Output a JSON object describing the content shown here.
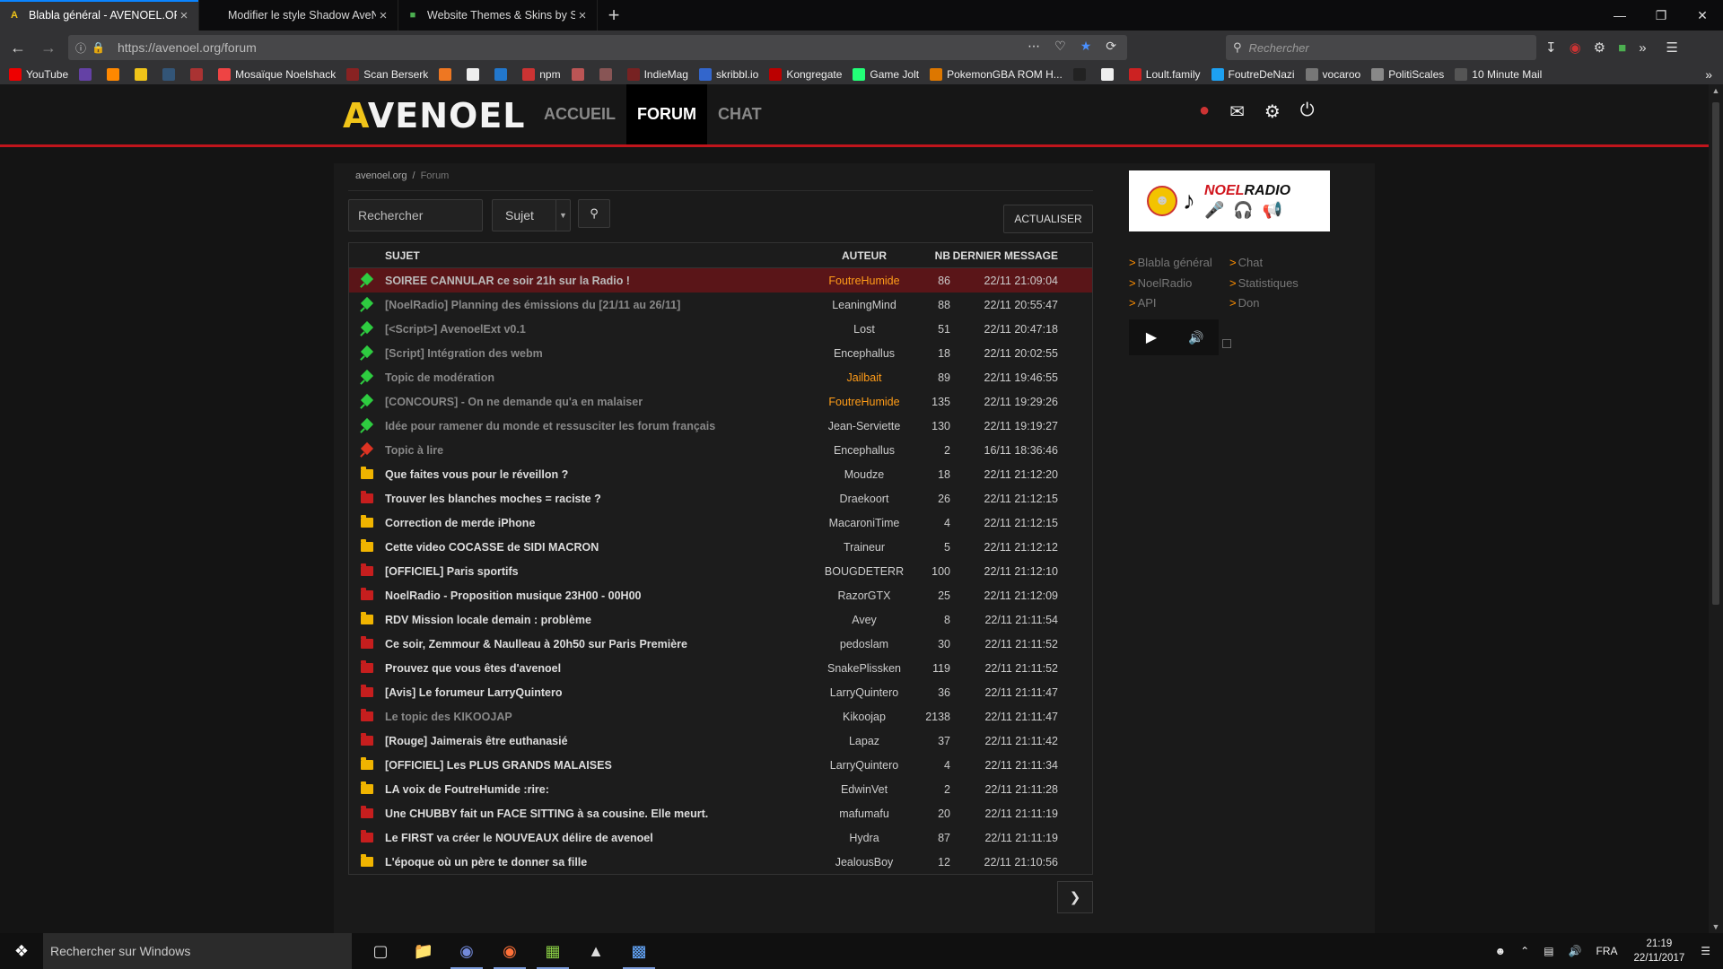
{
  "browser": {
    "tabs": [
      {
        "title": "Blabla général - AVENOEL.ORG",
        "favicon": "avenoel-icon",
        "favicon_char": "A",
        "favicon_color": "#f0c419",
        "active": true
      },
      {
        "title": "Modifier le style Shadow AveNoël",
        "favicon": "",
        "favicon_char": "",
        "favicon_color": "#888",
        "active": false
      },
      {
        "title": "Website Themes & Skins by Sty",
        "favicon": "stylish-icon",
        "favicon_char": "■",
        "favicon_color": "#4caf50",
        "active": false
      }
    ],
    "url": "https://avenoel.org/forum",
    "search_placeholder": "Rechercher",
    "bookmarks": [
      {
        "label": "YouTube",
        "color": "#e00"
      },
      {
        "label": "",
        "color": "#6441a5"
      },
      {
        "label": "",
        "color": "#f80"
      },
      {
        "label": "",
        "color": "#f0c419"
      },
      {
        "label": "",
        "color": "#357"
      },
      {
        "label": "",
        "color": "#a33"
      },
      {
        "label": "Mosaïque Noelshack",
        "color": "#e44"
      },
      {
        "label": "Scan Berserk",
        "color": "#822"
      },
      {
        "label": "",
        "color": "#e72"
      },
      {
        "label": "",
        "color": "#eee"
      },
      {
        "label": "",
        "color": "#27c"
      },
      {
        "label": "npm",
        "color": "#c33"
      },
      {
        "label": "",
        "color": "#b55"
      },
      {
        "label": "",
        "color": "#855"
      },
      {
        "label": "IndieMag",
        "color": "#722"
      },
      {
        "label": "skribbl.io",
        "color": "#36c"
      },
      {
        "label": "Kongregate",
        "color": "#b00"
      },
      {
        "label": "Game Jolt",
        "color": "#2f7"
      },
      {
        "label": "PokemonGBA ROM H...",
        "color": "#d70"
      },
      {
        "label": "",
        "color": "#222"
      },
      {
        "label": "",
        "color": "#eee"
      },
      {
        "label": "Loult.family",
        "color": "#c22"
      },
      {
        "label": "FoutreDeNazi",
        "color": "#1da1f2"
      },
      {
        "label": "vocaroo",
        "color": "#777"
      },
      {
        "label": "PolitiScales",
        "color": "#888"
      },
      {
        "label": "10 Minute Mail",
        "color": "#555"
      }
    ]
  },
  "site": {
    "logo": "AVENOEL",
    "nav": [
      {
        "label": "ACCUEIL",
        "active": false
      },
      {
        "label": "FORUM",
        "active": true
      },
      {
        "label": "CHAT",
        "active": false
      }
    ]
  },
  "forum": {
    "breadcrumb": {
      "home": "avenoel.org",
      "sep": "/",
      "current": "Forum"
    },
    "search_placeholder": "Rechercher",
    "filter_selected": "Sujet",
    "refresh_label": "ACTUALISER",
    "columns": {
      "subject": "SUJET",
      "author": "AUTEUR",
      "nb": "NB",
      "last": "DERNIER MESSAGE"
    },
    "topics": [
      {
        "icon": "pin-green",
        "subject": "SOIREE CANNULAR ce soir 21h sur la Radio !",
        "author": "FoutreHumide",
        "special": true,
        "nb": "86",
        "last": "22/11 21:09:04",
        "pinned": true,
        "highlight": true
      },
      {
        "icon": "pin-green",
        "subject": "[NoelRadio] Planning des émissions du [21/11 au 26/11]",
        "author": "LeaningMind",
        "special": false,
        "nb": "88",
        "last": "22/11 20:55:47",
        "pinned": true
      },
      {
        "icon": "pin-green",
        "subject": "[<Script>] AvenoelExt v0.1",
        "author": "Lost",
        "special": false,
        "nb": "51",
        "last": "22/11 20:47:18",
        "pinned": true
      },
      {
        "icon": "pin-green",
        "subject": "[Script] Intégration des webm",
        "author": "Encephallus",
        "special": false,
        "nb": "18",
        "last": "22/11 20:02:55",
        "pinned": true
      },
      {
        "icon": "pin-green",
        "subject": "Topic de modération",
        "author": "Jailbait",
        "special": true,
        "nb": "89",
        "last": "22/11 19:46:55",
        "pinned": true
      },
      {
        "icon": "pin-green",
        "subject": "[CONCOURS] - On ne demande qu'a en malaiser",
        "author": "FoutreHumide",
        "special": true,
        "nb": "135",
        "last": "22/11 19:29:26",
        "pinned": true
      },
      {
        "icon": "pin-green",
        "subject": "Idée pour ramener du monde et ressusciter les forum français",
        "author": "Jean-Serviette",
        "special": false,
        "nb": "130",
        "last": "22/11 19:19:27",
        "pinned": true
      },
      {
        "icon": "pin-red",
        "subject": "Topic à lire",
        "author": "Encephallus",
        "special": false,
        "nb": "2",
        "last": "16/11 18:36:46",
        "pinned": true
      },
      {
        "icon": "folder-yellow",
        "subject": "Que faites vous pour le réveillon ?",
        "author": "Moudze",
        "special": false,
        "nb": "18",
        "last": "22/11 21:12:20"
      },
      {
        "icon": "folder-red",
        "subject": "Trouver les blanches moches = raciste ?",
        "author": "Draekoort",
        "special": false,
        "nb": "26",
        "last": "22/11 21:12:15"
      },
      {
        "icon": "folder-yellow",
        "subject": "Correction de merde iPhone",
        "author": "MacaroniTime",
        "special": false,
        "nb": "4",
        "last": "22/11 21:12:15"
      },
      {
        "icon": "folder-yellow",
        "subject": "Cette video COCASSE de SIDI MACRON",
        "author": "Traineur",
        "special": false,
        "nb": "5",
        "last": "22/11 21:12:12"
      },
      {
        "icon": "folder-red",
        "subject": "[OFFICIEL] Paris sportifs",
        "author": "BOUGDETERR",
        "special": false,
        "nb": "100",
        "last": "22/11 21:12:10"
      },
      {
        "icon": "folder-red",
        "subject": "NoelRadio - Proposition musique 23H00 - 00H00",
        "author": "RazorGTX",
        "special": false,
        "nb": "25",
        "last": "22/11 21:12:09"
      },
      {
        "icon": "folder-yellow",
        "subject": "RDV Mission locale demain : problème",
        "author": "Avey",
        "special": false,
        "nb": "8",
        "last": "22/11 21:11:54"
      },
      {
        "icon": "folder-red",
        "subject": "Ce soir, Zemmour & Naulleau à 20h50 sur Paris Première",
        "author": "pedoslam",
        "special": false,
        "nb": "30",
        "last": "22/11 21:11:52"
      },
      {
        "icon": "folder-red",
        "subject": "Prouvez que vous êtes d'avenoel",
        "author": "SnakePlissken",
        "special": false,
        "nb": "119",
        "last": "22/11 21:11:52"
      },
      {
        "icon": "folder-red",
        "subject": "[Avis] Le forumeur LarryQuintero",
        "author": "LarryQuintero",
        "special": false,
        "nb": "36",
        "last": "22/11 21:11:47"
      },
      {
        "icon": "folder-red",
        "subject": "Le topic des KIKOOJAP",
        "author": "Kikoojap",
        "special": false,
        "nb": "2138",
        "last": "22/11 21:11:47",
        "pinned": true
      },
      {
        "icon": "folder-red",
        "subject": "[Rouge] Jaimerais être euthanasié",
        "author": "Lapaz",
        "special": false,
        "nb": "37",
        "last": "22/11 21:11:42"
      },
      {
        "icon": "folder-yellow",
        "subject": "[OFFICIEL] Les PLUS GRANDS MALAISES",
        "author": "LarryQuintero",
        "special": false,
        "nb": "4",
        "last": "22/11 21:11:34"
      },
      {
        "icon": "folder-yellow",
        "subject": "LA voix de FoutreHumide :rire:",
        "author": "EdwinVet",
        "special": false,
        "nb": "2",
        "last": "22/11 21:11:28"
      },
      {
        "icon": "folder-red",
        "subject": "Une CHUBBY fait un FACE SITTING à sa cousine. Elle meurt.",
        "author": "mafumafu",
        "special": false,
        "nb": "20",
        "last": "22/11 21:11:19"
      },
      {
        "icon": "folder-red",
        "subject": "Le FIRST va créer le NOUVEAUX délire de avenoel",
        "author": "Hydra",
        "special": false,
        "nb": "87",
        "last": "22/11 21:11:19"
      },
      {
        "icon": "folder-yellow",
        "subject": "L'époque où un père te donner sa fille",
        "author": "JealousBoy",
        "special": false,
        "nb": "12",
        "last": "22/11 21:10:56"
      }
    ]
  },
  "sidebar": {
    "radio": {
      "title_a": "NOEL",
      "title_b": "RADIO"
    },
    "links": [
      "Blabla général",
      "Chat",
      "NoelRadio",
      "Statistiques",
      "API",
      "Don"
    ]
  },
  "taskbar": {
    "search_placeholder": "Rechercher sur Windows",
    "lang": "FRA",
    "time": "21:19",
    "date": "22/11/2017"
  },
  "colors": {
    "accent_red": "#c0151c",
    "special_author": "#ff9c18",
    "pin_green": "#2ecc40"
  }
}
